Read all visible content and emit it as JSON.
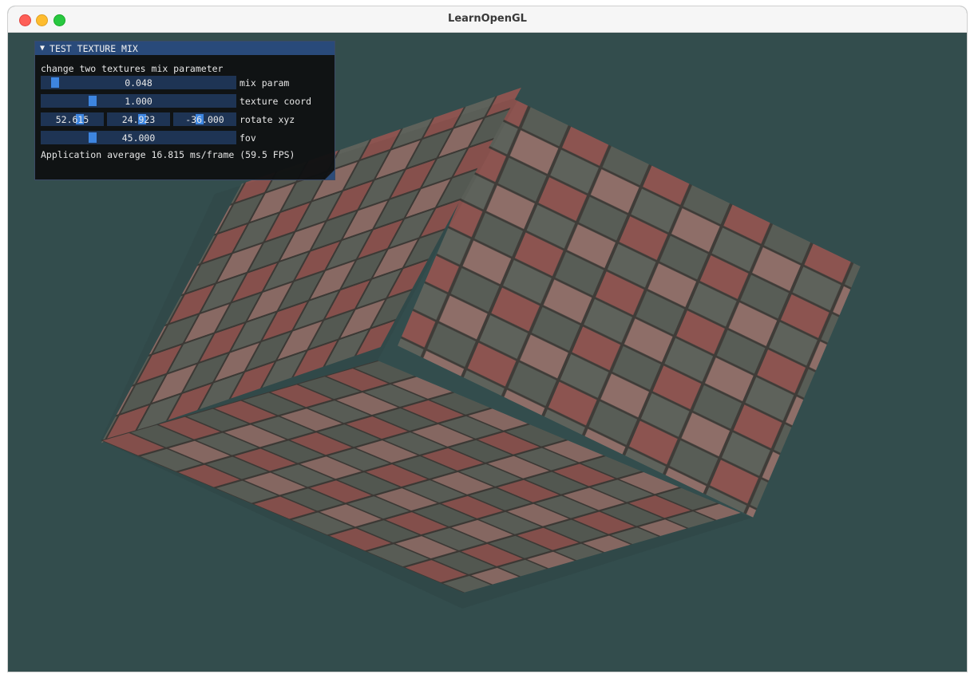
{
  "window": {
    "title": "LearnOpenGL"
  },
  "panel": {
    "header": "TEST TEXTURE MIX",
    "description": "change two textures mix parameter",
    "mix": {
      "value": "0.048",
      "label": "mix param",
      "fraction": 0.048
    },
    "texcoord": {
      "value": "1.000",
      "label": "texture coord",
      "fraction": 0.27
    },
    "rotate": {
      "x": "52.615",
      "y": "24.923",
      "z": "-36.000",
      "label": "rotate xyz",
      "fractions": [
        0.62,
        0.57,
        0.41
      ]
    },
    "fov": {
      "value": "45.000",
      "label": "fov",
      "fraction": 0.27
    },
    "stats": "Application average 16.815 ms/frame (59.5 FPS)"
  },
  "colors": {
    "background": "#334d4d",
    "panel_header": "#294a7a",
    "slider_bg": "#1e3454",
    "grab": "#3d85e0",
    "tile_red": "#8c5450",
    "tile_gray": "#585d56",
    "tile_light": "#8e6e68",
    "grout": "#3f3c38"
  },
  "scene": {
    "object": "textured-cube",
    "texture": "brick-checker-tiles"
  }
}
